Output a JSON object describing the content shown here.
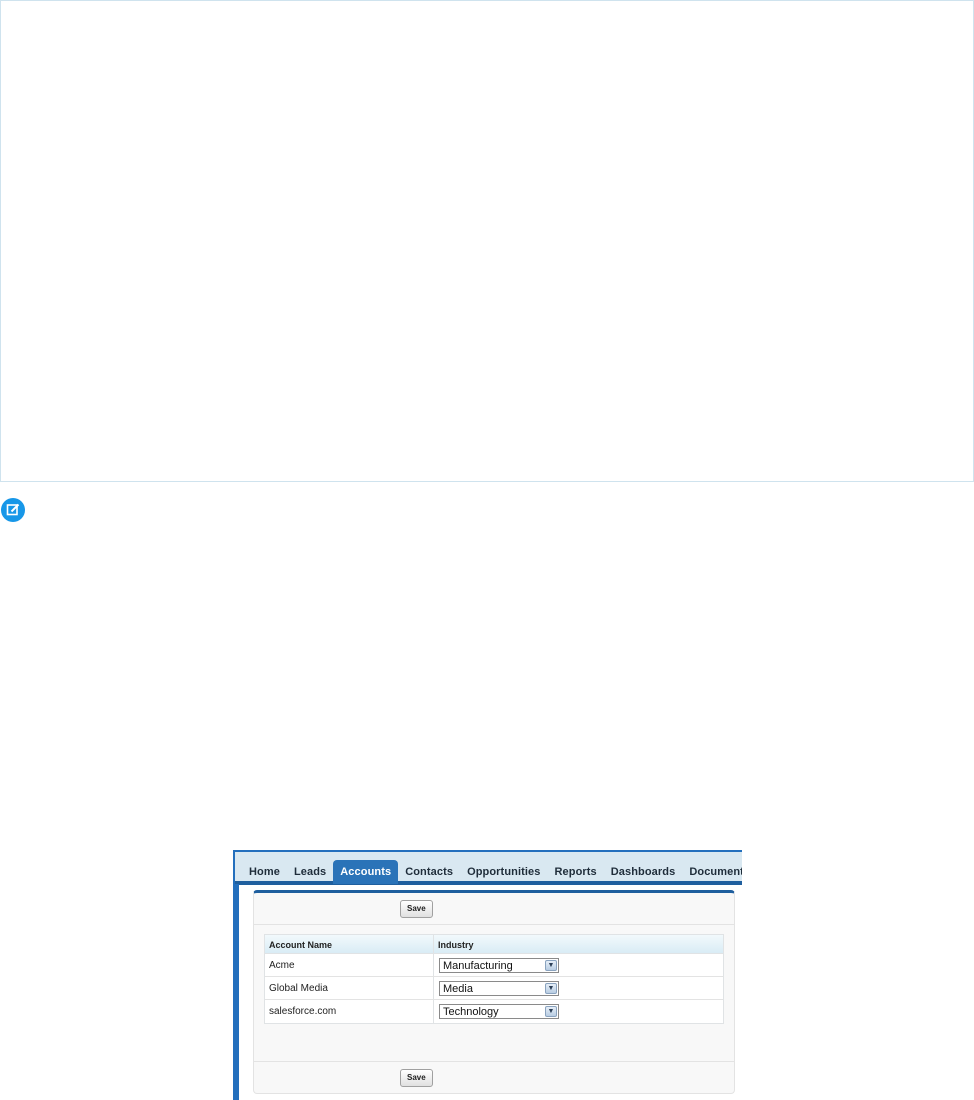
{
  "page": {
    "note_icon": "edit-note-icon"
  },
  "tabs": [
    {
      "label": "Home",
      "active": false
    },
    {
      "label": "Leads",
      "active": false
    },
    {
      "label": "Accounts",
      "active": true
    },
    {
      "label": "Contacts",
      "active": false
    },
    {
      "label": "Opportunities",
      "active": false
    },
    {
      "label": "Reports",
      "active": false
    },
    {
      "label": "Dashboards",
      "active": false
    },
    {
      "label": "Documents",
      "active": false
    }
  ],
  "form": {
    "save_top_label": "Save",
    "save_bottom_label": "Save",
    "columns": [
      "Account Name",
      "Industry"
    ],
    "rows": [
      {
        "name": "Acme",
        "industry": "Manufacturing"
      },
      {
        "name": "Global Media",
        "industry": "Media"
      },
      {
        "name": "salesforce.com",
        "industry": "Technology"
      }
    ]
  },
  "colors": {
    "accent": "#236fbd",
    "note_icon": "#1797e8"
  }
}
